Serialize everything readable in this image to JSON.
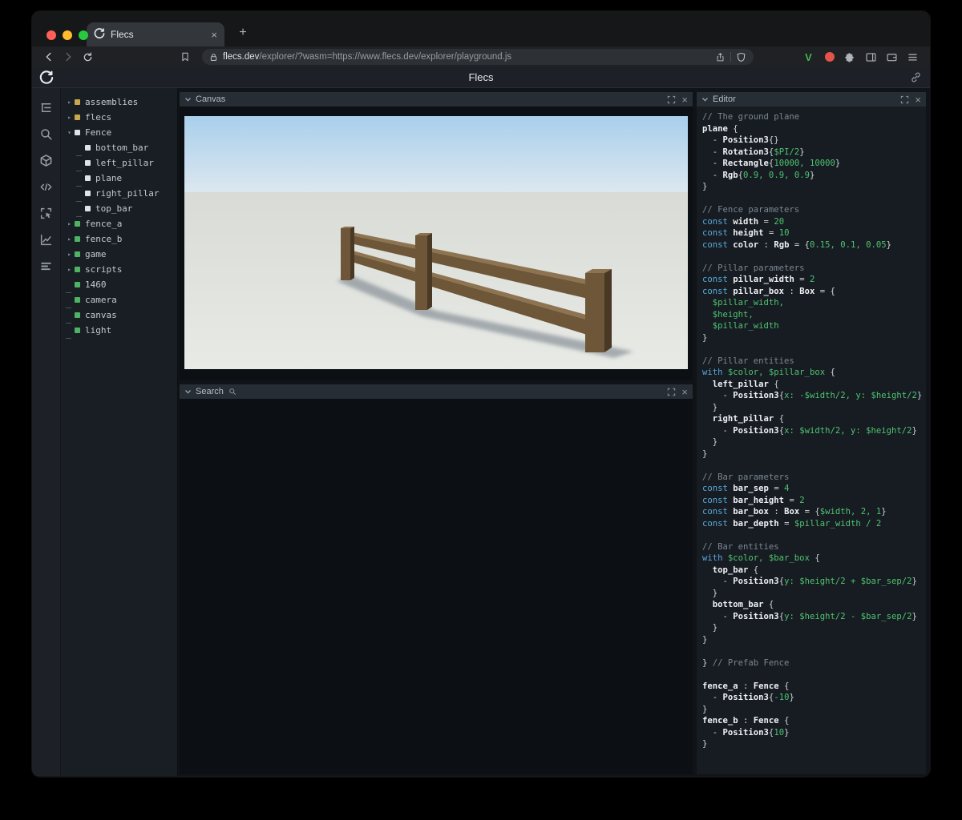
{
  "colors": {
    "module": "#c9a84c",
    "prefab": "#dfe3e7",
    "entity": "#4fb364",
    "keyword": "#58a8dc",
    "value": "#4ec370",
    "comment": "#7b8691",
    "plain": "#ced4da",
    "identifier": "#eef1f4",
    "traffic_close": "#ff5f57",
    "traffic_minimize": "#febc2e",
    "traffic_zoom": "#28c840",
    "ext_v_green": "#3fb950",
    "ext_red": "#e5534b",
    "sky_top": "#a9cfec",
    "sky_horizon": "#dce8ef",
    "ground_far": "#d8dbd6",
    "ground_near": "#e8eae6",
    "wood_front": "#6e5738",
    "wood_top": "#8d7350",
    "wood_side": "#493823",
    "shadow": "rgba(100,110,122,0.5)"
  },
  "browser": {
    "tab": {
      "title": "Flecs",
      "close_label": "×"
    },
    "new_tab_label": "+",
    "url": {
      "host": "flecs.dev",
      "path": "/explorer/?wasm=https://www.flecs.dev/explorer/playground.js"
    }
  },
  "app": {
    "header_title": "Flecs"
  },
  "extensions": {
    "v_label": "V"
  },
  "sidebar": {
    "icons": [
      "tree",
      "search",
      "cube",
      "code",
      "inspector",
      "chart",
      "stats"
    ]
  },
  "tree": {
    "items": [
      {
        "label": "assemblies",
        "kind": "module",
        "arrow": "right",
        "indent": 0
      },
      {
        "label": "flecs",
        "kind": "module",
        "arrow": "right",
        "indent": 0
      },
      {
        "label": "Fence",
        "kind": "prefab",
        "arrow": "down",
        "indent": 0
      },
      {
        "label": "bottom_bar",
        "kind": "prefab",
        "arrow": "none",
        "indent": 1
      },
      {
        "label": "left_pillar",
        "kind": "prefab",
        "arrow": "none",
        "indent": 1
      },
      {
        "label": "plane",
        "kind": "prefab",
        "arrow": "none",
        "indent": 1
      },
      {
        "label": "right_pillar",
        "kind": "prefab",
        "arrow": "none",
        "indent": 1
      },
      {
        "label": "top_bar",
        "kind": "prefab",
        "arrow": "none",
        "indent": 1
      },
      {
        "label": "fence_a",
        "kind": "entity",
        "arrow": "right",
        "indent": 0
      },
      {
        "label": "fence_b",
        "kind": "entity",
        "arrow": "right",
        "indent": 0
      },
      {
        "label": "game",
        "kind": "entity",
        "arrow": "right",
        "indent": 0
      },
      {
        "label": "scripts",
        "kind": "entity",
        "arrow": "right",
        "indent": 0
      },
      {
        "label": "1460",
        "kind": "entity",
        "arrow": "none",
        "indent": 0
      },
      {
        "label": "camera",
        "kind": "entity",
        "arrow": "none",
        "indent": 0
      },
      {
        "label": "canvas",
        "kind": "entity",
        "arrow": "none",
        "indent": 0
      },
      {
        "label": "light",
        "kind": "entity",
        "arrow": "none",
        "indent": 0
      }
    ]
  },
  "panels": {
    "canvas": {
      "title": "Canvas"
    },
    "search": {
      "title": "Search"
    },
    "editor": {
      "title": "Editor"
    }
  },
  "editor": {
    "lines": [
      [
        [
          "cm",
          "// The ground plane"
        ]
      ],
      [
        [
          "id",
          "plane"
        ],
        [
          "pl",
          " {"
        ]
      ],
      [
        [
          "pl",
          "  - "
        ],
        [
          "id",
          "Position3"
        ],
        [
          "pl",
          "{}"
        ]
      ],
      [
        [
          "pl",
          "  - "
        ],
        [
          "id",
          "Rotation3"
        ],
        [
          "pl",
          "{"
        ],
        [
          "vl",
          "$PI/2"
        ],
        [
          "pl",
          "}"
        ]
      ],
      [
        [
          "pl",
          "  - "
        ],
        [
          "id",
          "Rectangle"
        ],
        [
          "pl",
          "{"
        ],
        [
          "vl",
          "10000, 10000"
        ],
        [
          "pl",
          "}"
        ]
      ],
      [
        [
          "pl",
          "  - "
        ],
        [
          "id",
          "Rgb"
        ],
        [
          "pl",
          "{"
        ],
        [
          "vl",
          "0.9, 0.9, 0.9"
        ],
        [
          "pl",
          "}"
        ]
      ],
      [
        [
          "pl",
          "}"
        ]
      ],
      [],
      [
        [
          "cm",
          "// Fence parameters"
        ]
      ],
      [
        [
          "kw",
          "const "
        ],
        [
          "id",
          "width"
        ],
        [
          "pl",
          " = "
        ],
        [
          "vl",
          "20"
        ]
      ],
      [
        [
          "kw",
          "const "
        ],
        [
          "id",
          "height"
        ],
        [
          "pl",
          " = "
        ],
        [
          "vl",
          "10"
        ]
      ],
      [
        [
          "kw",
          "const "
        ],
        [
          "id",
          "color"
        ],
        [
          "pl",
          " : "
        ],
        [
          "id",
          "Rgb"
        ],
        [
          "pl",
          " = {"
        ],
        [
          "vl",
          "0.15, 0.1, 0.05"
        ],
        [
          "pl",
          "}"
        ]
      ],
      [],
      [
        [
          "cm",
          "// Pillar parameters"
        ]
      ],
      [
        [
          "kw",
          "const "
        ],
        [
          "id",
          "pillar_width"
        ],
        [
          "pl",
          " = "
        ],
        [
          "vl",
          "2"
        ]
      ],
      [
        [
          "kw",
          "const "
        ],
        [
          "id",
          "pillar_box"
        ],
        [
          "pl",
          " : "
        ],
        [
          "id",
          "Box"
        ],
        [
          "pl",
          " = {"
        ]
      ],
      [
        [
          "vl",
          "  $pillar_width,"
        ]
      ],
      [
        [
          "vl",
          "  $height,"
        ]
      ],
      [
        [
          "vl",
          "  $pillar_width"
        ]
      ],
      [
        [
          "pl",
          "}"
        ]
      ],
      [],
      [
        [
          "cm",
          "// Pillar entities"
        ]
      ],
      [
        [
          "kw",
          "with "
        ],
        [
          "vl",
          "$color, $pillar_box"
        ],
        [
          "pl",
          " {"
        ]
      ],
      [
        [
          "pl",
          "  "
        ],
        [
          "id",
          "left_pillar"
        ],
        [
          "pl",
          " {"
        ]
      ],
      [
        [
          "pl",
          "    - "
        ],
        [
          "id",
          "Position3"
        ],
        [
          "pl",
          "{"
        ],
        [
          "vl",
          "x: -$width/2, y: $height/2"
        ],
        [
          "pl",
          "}"
        ]
      ],
      [
        [
          "pl",
          "  }"
        ]
      ],
      [
        [
          "pl",
          "  "
        ],
        [
          "id",
          "right_pillar"
        ],
        [
          "pl",
          " {"
        ]
      ],
      [
        [
          "pl",
          "    - "
        ],
        [
          "id",
          "Position3"
        ],
        [
          "pl",
          "{"
        ],
        [
          "vl",
          "x: $width/2, y: $height/2"
        ],
        [
          "pl",
          "}"
        ]
      ],
      [
        [
          "pl",
          "  }"
        ]
      ],
      [
        [
          "pl",
          "}"
        ]
      ],
      [],
      [
        [
          "cm",
          "// Bar parameters"
        ]
      ],
      [
        [
          "kw",
          "const "
        ],
        [
          "id",
          "bar_sep"
        ],
        [
          "pl",
          " = "
        ],
        [
          "vl",
          "4"
        ]
      ],
      [
        [
          "kw",
          "const "
        ],
        [
          "id",
          "bar_height"
        ],
        [
          "pl",
          " = "
        ],
        [
          "vl",
          "2"
        ]
      ],
      [
        [
          "kw",
          "const "
        ],
        [
          "id",
          "bar_box"
        ],
        [
          "pl",
          " : "
        ],
        [
          "id",
          "Box"
        ],
        [
          "pl",
          " = {"
        ],
        [
          "vl",
          "$width, 2, 1"
        ],
        [
          "pl",
          "}"
        ]
      ],
      [
        [
          "kw",
          "const "
        ],
        [
          "id",
          "bar_depth"
        ],
        [
          "pl",
          " = "
        ],
        [
          "vl",
          "$pillar_width / 2"
        ]
      ],
      [],
      [
        [
          "cm",
          "// Bar entities"
        ]
      ],
      [
        [
          "kw",
          "with "
        ],
        [
          "vl",
          "$color, $bar_box"
        ],
        [
          "pl",
          " {"
        ]
      ],
      [
        [
          "pl",
          "  "
        ],
        [
          "id",
          "top_bar"
        ],
        [
          "pl",
          " {"
        ]
      ],
      [
        [
          "pl",
          "    - "
        ],
        [
          "id",
          "Position3"
        ],
        [
          "pl",
          "{"
        ],
        [
          "vl",
          "y: $height/2 + $bar_sep/2"
        ],
        [
          "pl",
          "}"
        ]
      ],
      [
        [
          "pl",
          "  }"
        ]
      ],
      [
        [
          "pl",
          "  "
        ],
        [
          "id",
          "bottom_bar"
        ],
        [
          "pl",
          " {"
        ]
      ],
      [
        [
          "pl",
          "    - "
        ],
        [
          "id",
          "Position3"
        ],
        [
          "pl",
          "{"
        ],
        [
          "vl",
          "y: $height/2 - $bar_sep/2"
        ],
        [
          "pl",
          "}"
        ]
      ],
      [
        [
          "pl",
          "  }"
        ]
      ],
      [
        [
          "pl",
          "}"
        ]
      ],
      [],
      [
        [
          "pl",
          "} "
        ],
        [
          "cm",
          "// Prefab Fence"
        ]
      ],
      [],
      [
        [
          "id",
          "fence_a"
        ],
        [
          "pl",
          " : "
        ],
        [
          "id",
          "Fence"
        ],
        [
          "pl",
          " {"
        ]
      ],
      [
        [
          "pl",
          "  - "
        ],
        [
          "id",
          "Position3"
        ],
        [
          "pl",
          "{"
        ],
        [
          "vl",
          "-10"
        ],
        [
          "pl",
          "}"
        ]
      ],
      [
        [
          "pl",
          "}"
        ]
      ],
      [
        [
          "id",
          "fence_b"
        ],
        [
          "pl",
          " : "
        ],
        [
          "id",
          "Fence"
        ],
        [
          "pl",
          " {"
        ]
      ],
      [
        [
          "pl",
          "  - "
        ],
        [
          "id",
          "Position3"
        ],
        [
          "pl",
          "{"
        ],
        [
          "vl",
          "10"
        ],
        [
          "pl",
          "}"
        ]
      ],
      [
        [
          "pl",
          "}"
        ]
      ]
    ]
  }
}
